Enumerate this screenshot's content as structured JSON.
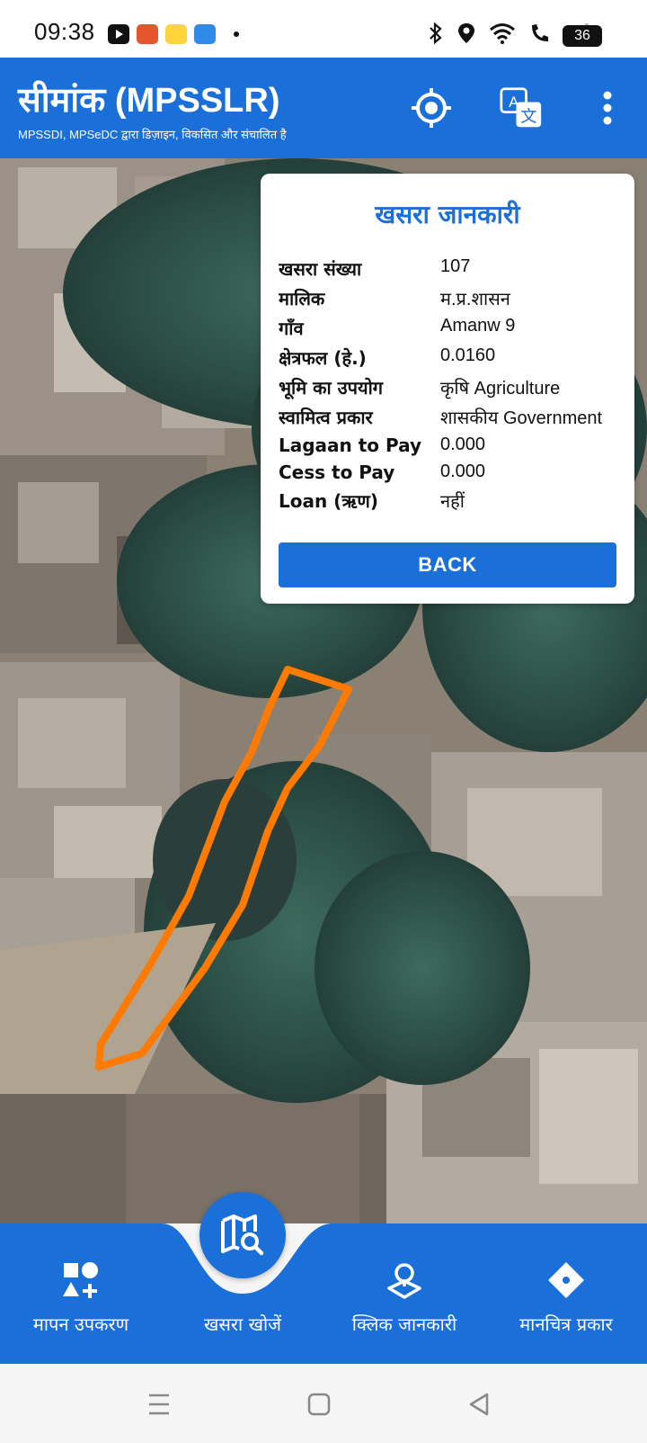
{
  "status_bar": {
    "time": "09:38",
    "battery": "36"
  },
  "app_bar": {
    "title": "सीमांक (MPSSLR)",
    "subtitle": "MPSSDI, MPSeDC द्वारा डिज़ाइन, विकसित और संचालित है",
    "locate_icon": "crosshair-icon",
    "translate_icon": "translate-icon",
    "menu_icon": "more-vert-icon"
  },
  "card": {
    "title": "खसरा जानकारी",
    "rows": [
      {
        "label": "खसरा संख्या",
        "value": "107"
      },
      {
        "label": "मालिक",
        "value": "म.प्र.शासन"
      },
      {
        "label": "गाँव",
        "value": "Amanw 9"
      },
      {
        "label": "क्षेत्रफल (हे.)",
        "value": "0.0160"
      },
      {
        "label": "भूमि का उपयोग",
        "value": "कृषि Agriculture"
      },
      {
        "label": "स्वामित्व प्रकार",
        "value": "शासकीय Government"
      },
      {
        "label": "Lagaan to Pay",
        "value": "0.000"
      },
      {
        "label": "Cess to Pay",
        "value": "0.000"
      },
      {
        "label": "Loan (ऋण)",
        "value": "नहीं"
      }
    ],
    "back_label": "BACK"
  },
  "bottom_nav": {
    "items": [
      {
        "label": "मापन उपकरण",
        "icon": "shapes-icon"
      },
      {
        "label": "खसरा खोजें",
        "icon": "map-search-icon"
      },
      {
        "label": "क्लिक जानकारी",
        "icon": "location-pin-icon"
      },
      {
        "label": "मानचित्र प्रकार",
        "icon": "layers-icon"
      }
    ]
  },
  "colors": {
    "primary": "#1a6fd9",
    "parcel_outline": "#ff7a00"
  }
}
